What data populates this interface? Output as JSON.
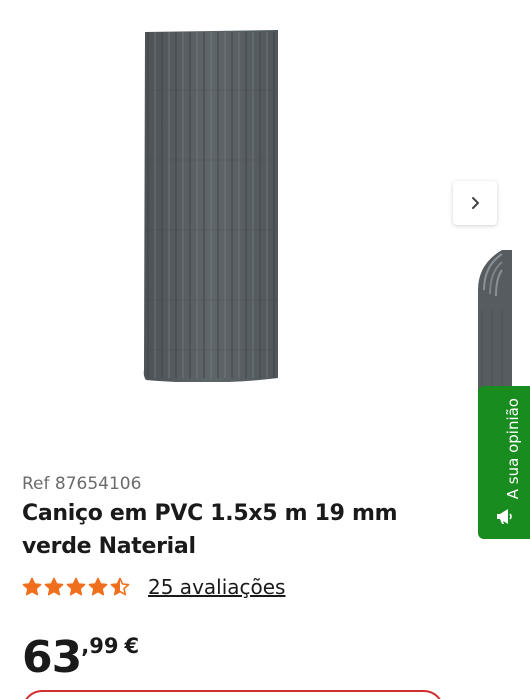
{
  "product": {
    "ref": "Ref 87654106",
    "title": "Caniço em PVC 1.5x5 m 19 mm verde Naterial",
    "rating": 4.5,
    "rating_max": 5,
    "reviews_label": "25 avaliações",
    "price": {
      "integer": "63",
      "decimal": ",99",
      "currency": "€"
    }
  },
  "feedback_tab": {
    "label": "A sua opinião",
    "icon": "megaphone-icon"
  },
  "gallery": {
    "next_icon": "chevron-right-icon"
  },
  "colors": {
    "accent_star": "#f06f1c",
    "feedback_green": "#188c1f",
    "cta_red": "#d22e2e",
    "product_gray": "#596064"
  }
}
